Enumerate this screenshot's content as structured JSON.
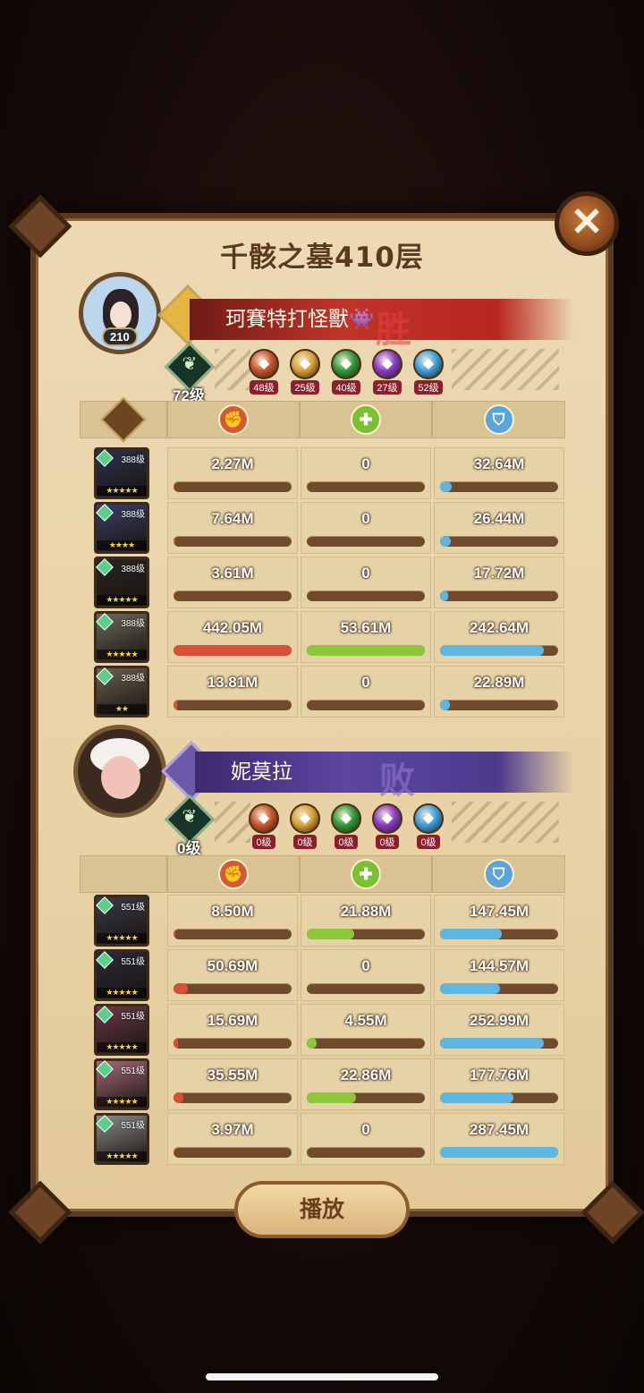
{
  "title": "千骸之墓410层",
  "close_label": "✕",
  "play_label": "播放",
  "team1": {
    "name": "珂賽特打怪獸👾",
    "result": "胜",
    "avatar_level": "210",
    "tree_level": "72级",
    "factions": [
      {
        "name": "lightbearer",
        "level": "48级",
        "color": "#c8562c"
      },
      {
        "name": "mauler",
        "level": "25级",
        "color": "#d7a23a"
      },
      {
        "name": "wilder",
        "level": "40级",
        "color": "#2f9a3a"
      },
      {
        "name": "graveborn",
        "level": "27级",
        "color": "#8a3bc8"
      },
      {
        "name": "celestial",
        "level": "52级",
        "color": "#3aa0e0"
      }
    ],
    "heroes": [
      {
        "level": "388级",
        "stars": "★★★★★",
        "damage": "2.27M",
        "damage_pct": 0.005,
        "heal": "0",
        "heal_pct": 0,
        "tank": "32.64M",
        "tank_pct": 0.1,
        "bg": "#2a3350"
      },
      {
        "level": "388级",
        "stars": "★★★★",
        "damage": "7.64M",
        "damage_pct": 0.017,
        "heal": "0",
        "heal_pct": 0,
        "tank": "26.44M",
        "tank_pct": 0.09,
        "bg": "#3a3f6a"
      },
      {
        "level": "388级",
        "stars": "★★★★★",
        "damage": "3.61M",
        "damage_pct": 0.008,
        "heal": "0",
        "heal_pct": 0,
        "tank": "17.72M",
        "tank_pct": 0.07,
        "bg": "#2a2424"
      },
      {
        "level": "388级",
        "stars": "★★★★★",
        "damage": "442.05M",
        "damage_pct": 1.0,
        "heal": "53.61M",
        "heal_pct": 1.0,
        "tank": "242.64M",
        "tank_pct": 0.88,
        "bg": "#6b6a5a"
      },
      {
        "level": "388级",
        "stars": "★★",
        "damage": "13.81M",
        "damage_pct": 0.03,
        "heal": "0",
        "heal_pct": 0,
        "tank": "22.89M",
        "tank_pct": 0.08,
        "bg": "#6b6050"
      }
    ]
  },
  "team2": {
    "name": "妮莫拉",
    "result": "败",
    "tree_level": "0级",
    "factions": [
      {
        "name": "lightbearer",
        "level": "0级",
        "color": "#c8562c"
      },
      {
        "name": "mauler",
        "level": "0级",
        "color": "#d7a23a"
      },
      {
        "name": "wilder",
        "level": "0级",
        "color": "#2f9a3a"
      },
      {
        "name": "graveborn",
        "level": "0级",
        "color": "#8a3bc8"
      },
      {
        "name": "celestial",
        "level": "0级",
        "color": "#3aa0e0"
      }
    ],
    "heroes": [
      {
        "level": "551级",
        "stars": "★★★★★",
        "damage": "8.50M",
        "damage_pct": 0.017,
        "heal": "21.88M",
        "heal_pct": 0.4,
        "tank": "147.45M",
        "tank_pct": 0.52,
        "bg": "#3a3a4a"
      },
      {
        "level": "551级",
        "stars": "★★★★★",
        "damage": "50.69M",
        "damage_pct": 0.12,
        "heal": "0",
        "heal_pct": 0,
        "tank": "144.57M",
        "tank_pct": 0.51,
        "bg": "#2a2a3a"
      },
      {
        "level": "551级",
        "stars": "★★★★★",
        "damage": "15.69M",
        "damage_pct": 0.035,
        "heal": "4.55M",
        "heal_pct": 0.08,
        "tank": "252.99M",
        "tank_pct": 0.88,
        "bg": "#6a3a4a"
      },
      {
        "level": "551级",
        "stars": "★★★★★",
        "damage": "35.55M",
        "damage_pct": 0.08,
        "heal": "22.86M",
        "heal_pct": 0.42,
        "tank": "177.76M",
        "tank_pct": 0.62,
        "bg": "#a46a7a"
      },
      {
        "level": "551级",
        "stars": "★★★★★",
        "damage": "3.97M",
        "damage_pct": 0.009,
        "heal": "0",
        "heal_pct": 0,
        "tank": "287.45M",
        "tank_pct": 1.0,
        "bg": "#8a8a8a"
      }
    ]
  },
  "icons": {
    "damage": "fist-icon",
    "heal": "heal-icon",
    "tank": "shield-icon",
    "report": "scroll-icon"
  }
}
